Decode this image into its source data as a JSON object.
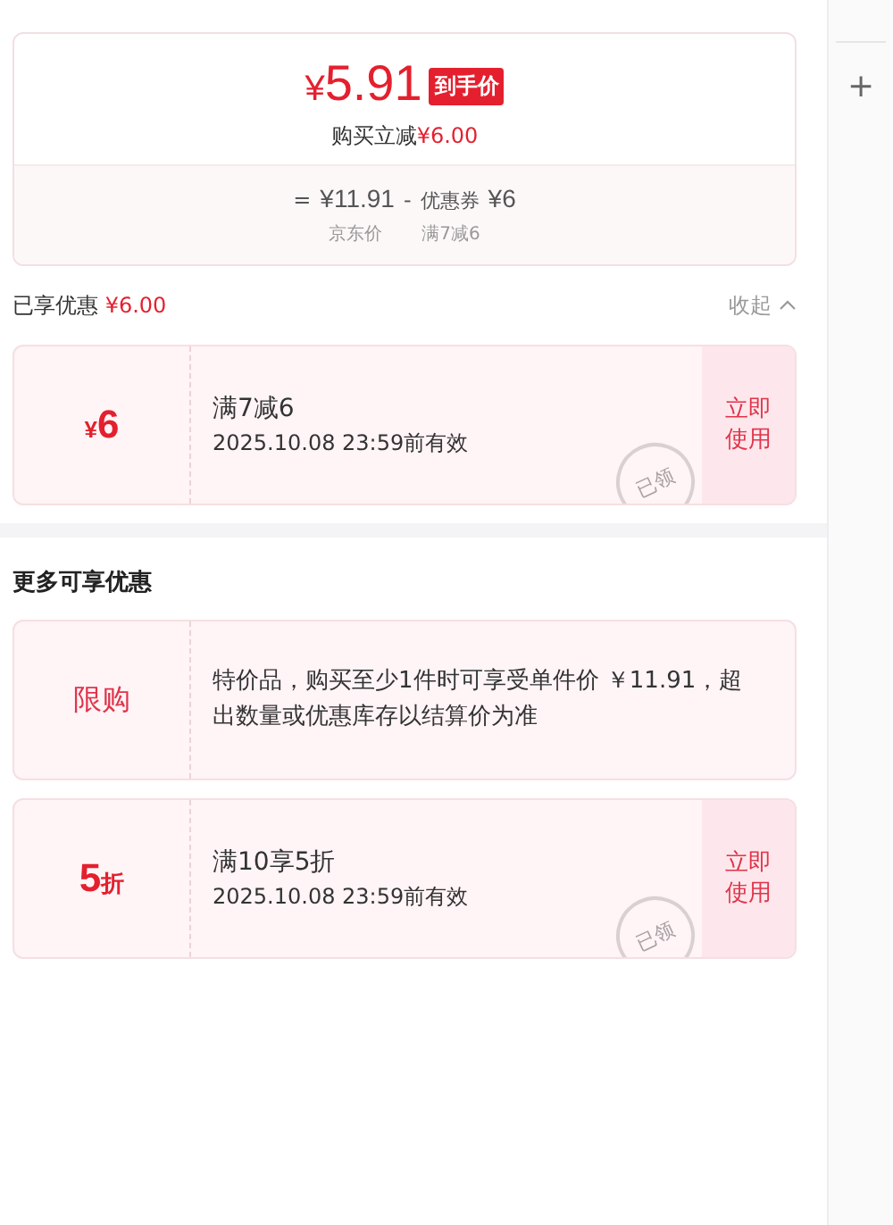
{
  "summary": {
    "price_symbol": "¥",
    "price": "5.91",
    "price_tag": "到手价",
    "reduce_label": "购买立减",
    "reduce_amount": "¥6.00",
    "formula_eq": "=",
    "base_price": "¥11.91",
    "minus": "-",
    "coupon_label": "优惠券",
    "coupon_amount": "¥6",
    "base_caption": "京东价",
    "coupon_caption": "满7减6"
  },
  "enjoyed": {
    "label": "已享优惠",
    "amount": "¥6.00",
    "toggle": "收起",
    "expanded": true
  },
  "enjoyed_coupons": [
    {
      "kind": "amount",
      "symbol": "¥",
      "value": "6",
      "title": "满7减6",
      "validity": "2025.10.08 23:59前有效",
      "stamp": "已领",
      "action": "立即使用"
    }
  ],
  "more_title": "更多可享优惠",
  "more_coupons": [
    {
      "kind": "limit",
      "value": "限购",
      "desc": "特价品，购买至少1件时可享受单件价 ￥11.91，超出数量或优惠库存以结算价为准"
    },
    {
      "kind": "discount",
      "value": "5",
      "unit": "折",
      "title": "满10享5折",
      "validity": "2025.10.08 23:59前有效",
      "stamp": "已领",
      "action": "立即使用"
    }
  ],
  "side": {
    "add": "+"
  }
}
